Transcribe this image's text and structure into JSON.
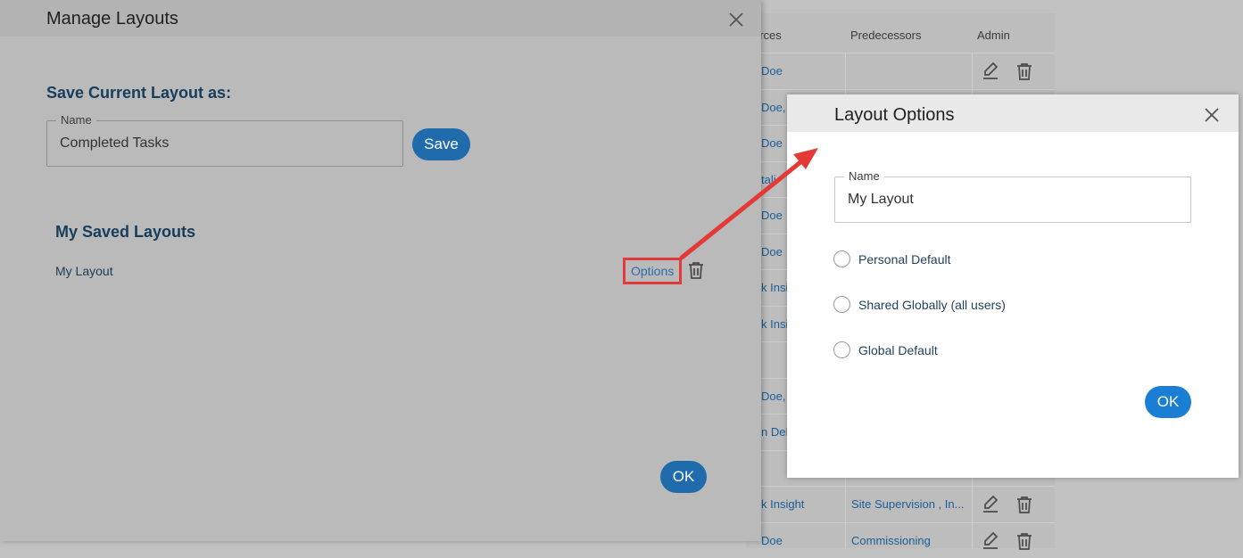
{
  "background_grid": {
    "headers": [
      "urces",
      "Predecessors",
      "Admin"
    ],
    "rows": [
      {
        "resource": "Doe",
        "predecessor": "",
        "icons": true
      },
      {
        "resource": "Doe,",
        "predecessor": "",
        "icons": false
      },
      {
        "resource": "Doe",
        "predecessor": "",
        "icons": false
      },
      {
        "resource": "tali",
        "predecessor": "",
        "icons": false
      },
      {
        "resource": "Doe",
        "predecessor": "",
        "icons": false
      },
      {
        "resource": "Doe",
        "predecessor": "",
        "icons": false
      },
      {
        "resource": "k Insi",
        "predecessor": "",
        "icons": false
      },
      {
        "resource": "k Insi",
        "predecessor": "",
        "icons": false
      },
      {
        "resource": "",
        "predecessor": "",
        "icons": false
      },
      {
        "resource": "Doe,",
        "predecessor": "",
        "icons": false
      },
      {
        "resource": "n DeN",
        "predecessor": "",
        "icons": false
      },
      {
        "resource": "",
        "predecessor": "",
        "icons": false
      },
      {
        "resource": "k Insight",
        "predecessor": "Site Supervision , In...",
        "icons": true
      },
      {
        "resource": "Doe",
        "predecessor": "Commissioning",
        "icons": true
      }
    ]
  },
  "manage_layouts": {
    "title": "Manage Layouts",
    "save_section_title": "Save Current Layout as:",
    "name_label": "Name",
    "name_value": "Completed Tasks",
    "save_button": "Save",
    "saved_section_title": "My Saved Layouts",
    "saved_layouts": [
      {
        "name": "My Layout",
        "options_label": "Options"
      }
    ],
    "ok_button": "OK"
  },
  "layout_options": {
    "title": "Layout Options",
    "name_label": "Name",
    "name_value": "My Layout",
    "radios": [
      {
        "label": "Personal Default"
      },
      {
        "label": "Shared Globally (all users)"
      },
      {
        "label": "Global Default"
      }
    ],
    "ok_button": "OK"
  },
  "colors": {
    "primary_button": "#1a7fd4",
    "primary_button_dimmed": "#1f6bab",
    "highlight_annotation": "#e03a3a"
  }
}
